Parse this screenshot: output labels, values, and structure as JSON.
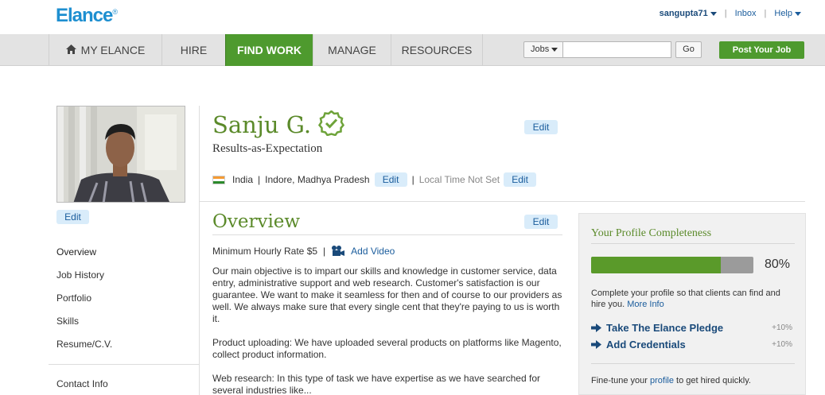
{
  "header": {
    "logo": "Elance",
    "logo_mark": "®",
    "user": "sangupta71",
    "inbox": "Inbox",
    "help": "Help"
  },
  "nav": {
    "items": [
      {
        "label": "MY ELANCE",
        "icon": "home-icon"
      },
      {
        "label": "HIRE"
      },
      {
        "label": "FIND WORK",
        "active": true
      },
      {
        "label": "MANAGE"
      },
      {
        "label": "RESOURCES"
      }
    ],
    "search_scope": "Jobs",
    "search_value": "",
    "go_label": "Go",
    "post_job_label": "Post Your Job"
  },
  "profile": {
    "photo_edit": "Edit",
    "name": "Sanju G.",
    "verified_icon": "verified-check-icon",
    "name_edit": "Edit",
    "tagline": "Results-as-Expectation",
    "country": "India",
    "sep1": "|",
    "city": "Indore, Madhya Pradesh",
    "location_edit": "Edit",
    "sep2": "|",
    "local_time": "Local Time Not Set",
    "time_edit": "Edit"
  },
  "sidebar": {
    "items": [
      "Overview",
      "Job History",
      "Portfolio",
      "Skills",
      "Resume/C.V."
    ],
    "contact": "Contact Info"
  },
  "overview": {
    "title": "Overview",
    "edit": "Edit",
    "rate": "Minimum Hourly Rate $5",
    "sep": "|",
    "add_video": "Add Video",
    "p1": "Our main objective is to impart our skills and knowledge in customer service, data entry, administrative support and web research. Customer's satisfaction is our guarantee. We want to make it seamless for then and of course to our providers as well. We always make sure that every single cent that they're paying to us is worth it.",
    "p2": "Product uploading: We have uploaded several products on platforms like Magento, collect product information.",
    "p3": "Web research: In this type of task we have expertise as we have searched for several industries like..."
  },
  "completeness": {
    "title": "Your Profile Completeness",
    "percent_value": 80,
    "percent_text": "80%",
    "text": "Complete your profile so that clients can find and hire you.",
    "more_info": "More Info",
    "actions": [
      {
        "label": "Take The Elance Pledge",
        "bonus": "+10%"
      },
      {
        "label": "Add Credentials",
        "bonus": "+10%"
      }
    ],
    "footer_pre": "Fine-tune your",
    "footer_link": "profile",
    "footer_post": "to get hired quickly."
  },
  "colors": {
    "brand_blue": "#1e8fd0",
    "brand_green": "#4e9a2e",
    "heading_green": "#5b8a2a",
    "link_blue": "#1a5c9c",
    "edit_pill": "#d9ecfa"
  }
}
